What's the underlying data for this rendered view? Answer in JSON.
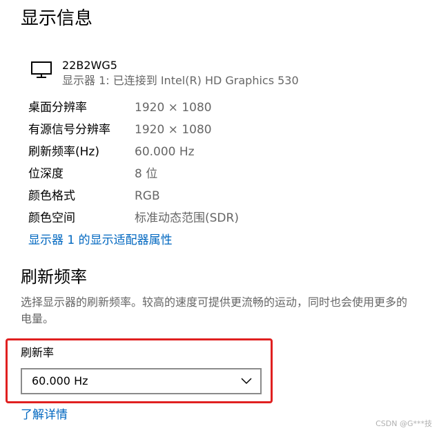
{
  "page": {
    "title": "显示信息"
  },
  "monitor": {
    "icon": "monitor-icon",
    "name": "22B2WG5",
    "subtitle": "显示器 1: 已连接到 Intel(R) HD Graphics 530"
  },
  "info_rows": [
    {
      "label": "桌面分辨率",
      "value": "1920 × 1080"
    },
    {
      "label": "有源信号分辨率",
      "value": "1920 × 1080"
    },
    {
      "label": "刷新频率(Hz)",
      "value": "60.000 Hz"
    },
    {
      "label": "位深度",
      "value": "8 位"
    },
    {
      "label": "颜色格式",
      "value": "RGB"
    },
    {
      "label": "颜色空间",
      "value": "标准动态范围(SDR)"
    }
  ],
  "adapter_link": "显示器 1 的显示适配器属性",
  "refresh_section": {
    "title": "刷新频率",
    "description": "选择显示器的刷新频率。较高的速度可提供更流畅的运动，同时也会使用更多的电量。",
    "rate_label": "刷新率",
    "rate_selected": "60.000 Hz",
    "learn_more": "了解详情"
  },
  "watermark": "CSDN @G***技",
  "colors": {
    "link": "#0067c0",
    "highlight_border": "#e02020",
    "secondary_text": "#666666"
  }
}
